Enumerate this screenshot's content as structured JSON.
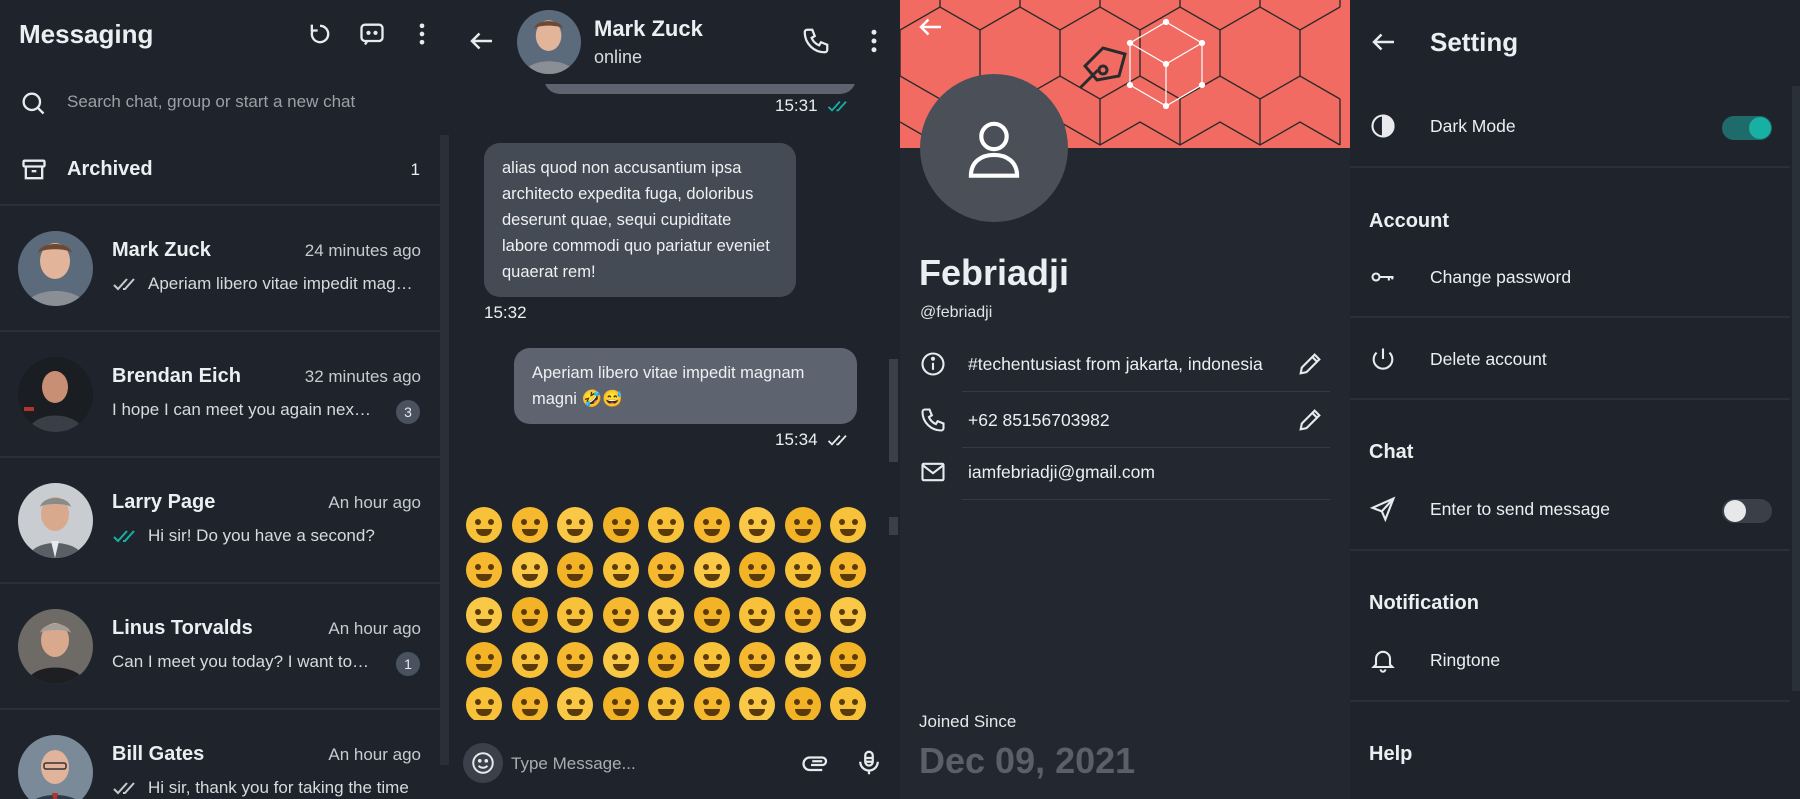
{
  "messaging": {
    "title": "Messaging",
    "search_placeholder": "Search chat, group or start a new chat",
    "archived": {
      "label": "Archived",
      "count": "1"
    },
    "chats": [
      {
        "name": "Mark Zuck",
        "time": "24 minutes ago",
        "preview": "Aperiam libero vitae impedit magnam magni",
        "ticks": "read-grey",
        "badge": ""
      },
      {
        "name": "Brendan Eich",
        "time": "32 minutes ago",
        "preview": "I hope I can meet you again next week",
        "ticks": "",
        "badge": "3"
      },
      {
        "name": "Larry Page",
        "time": "An hour ago",
        "preview": "Hi sir! Do you have a second?",
        "ticks": "read-teal",
        "badge": ""
      },
      {
        "name": "Linus Torvalds",
        "time": "An hour ago",
        "preview": "Can I meet you today? I want to ask something",
        "ticks": "",
        "badge": "1"
      },
      {
        "name": "Bill Gates",
        "time": "An hour ago",
        "preview": "Hi sir, thank you for taking the time",
        "ticks": "read-grey",
        "badge": ""
      }
    ]
  },
  "chat": {
    "contact_name": "Mark Zuck",
    "status": "online",
    "messages": [
      {
        "direction": "out",
        "text": "",
        "time": "15:31",
        "ticks": "read-teal"
      },
      {
        "direction": "in",
        "text": "alias quod non accusantium ipsa architecto expedita fuga, doloribus deserunt quae, sequi cupiditate labore commodi quo pariatur eveniet quaerat rem!",
        "time": "15:32"
      },
      {
        "direction": "out",
        "text": "Aperiam libero vitae impedit magnam magni 🤣😅",
        "time": "15:34",
        "ticks": "read-grey"
      }
    ],
    "emoji_rows": 5,
    "emoji_cols": 9,
    "composer_placeholder": "Type Message..."
  },
  "profile": {
    "name": "Febriadji",
    "handle": "@febriadji",
    "bio": "#techentusiast from jakarta, indonesia",
    "phone": "+62 85156703982",
    "email": "iamfebriadji@gmail.com",
    "joined_label": "Joined Since",
    "joined_date": "Dec 09, 2021",
    "cover_color": "#f26b63"
  },
  "settings": {
    "title": "Setting",
    "dark_mode": {
      "label": "Dark Mode",
      "enabled": true
    },
    "sections": {
      "account": "Account",
      "chat": "Chat",
      "notification": "Notification",
      "help": "Help"
    },
    "items": {
      "change_password": "Change password",
      "delete_account": "Delete account",
      "enter_to_send": {
        "label": "Enter to send message",
        "enabled": false
      },
      "ringtone": "Ringtone"
    },
    "accent": "#19b0a4"
  }
}
